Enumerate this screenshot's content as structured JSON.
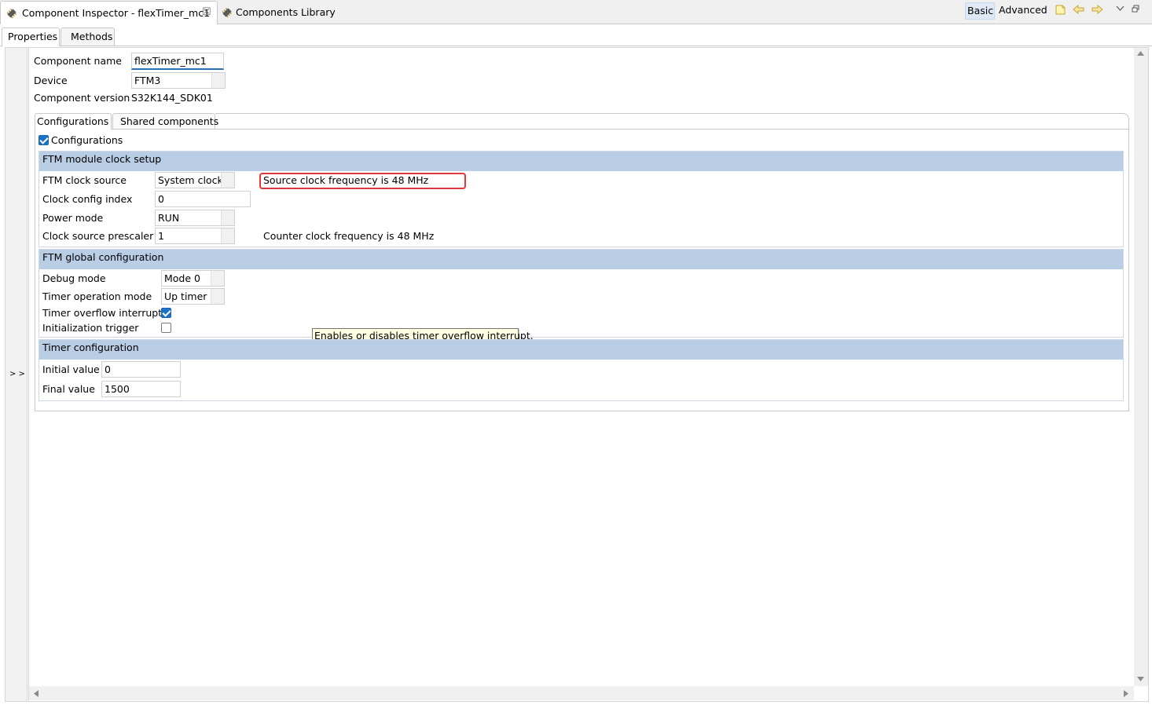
{
  "view_tabs": {
    "inspector": "Component Inspector - flexTimer_mc1",
    "library": "Components Library"
  },
  "toolbar": {
    "basic": "Basic",
    "advanced": "Advanced"
  },
  "sub_tabs": {
    "properties": "Properties",
    "methods": "Methods"
  },
  "left_strip": {
    "expand": "> >"
  },
  "component": {
    "name_label": "Component name",
    "name_value": "flexTimer_mc1",
    "device_label": "Device",
    "device_value": "FTM3",
    "version_label": "Component version",
    "version_value": "S32K144_SDK01"
  },
  "config_tabs": {
    "configurations": "Configurations",
    "shared": "Shared components"
  },
  "configurations_check": {
    "label": "Configurations",
    "checked": true
  },
  "clock_setup": {
    "title": "FTM module clock setup",
    "clock_source_label": "FTM clock source",
    "clock_source_value": "System clock",
    "source_freq_text": "Source clock frequency is 48 MHz",
    "config_index_label": "Clock config index",
    "config_index_value": "0",
    "power_mode_label": "Power mode",
    "power_mode_value": "RUN",
    "prescaler_label": "Clock source prescaler",
    "prescaler_value": "1",
    "counter_freq_text": "Counter clock frequency is 48 MHz"
  },
  "global_config": {
    "title": "FTM global configuration",
    "debug_label": "Debug mode",
    "debug_value": "Mode 0",
    "op_mode_label": "Timer operation mode",
    "op_mode_value": "Up timer",
    "overflow_label": "Timer overflow interrupt",
    "overflow_checked": true,
    "init_trigger_label": "Initialization trigger",
    "init_trigger_checked": false
  },
  "tooltip": "Enables or disables timer overflow interrupt.",
  "timer_config": {
    "title": "Timer configuration",
    "initial_label": "Initial value",
    "initial_value": "0",
    "final_label": "Final value",
    "final_value": "1500"
  },
  "colors": {
    "group_header": "#b9cde5",
    "highlight": "#e0383c",
    "checkbox": "#1a73c8",
    "tooltip_bg": "#ffffe1"
  }
}
